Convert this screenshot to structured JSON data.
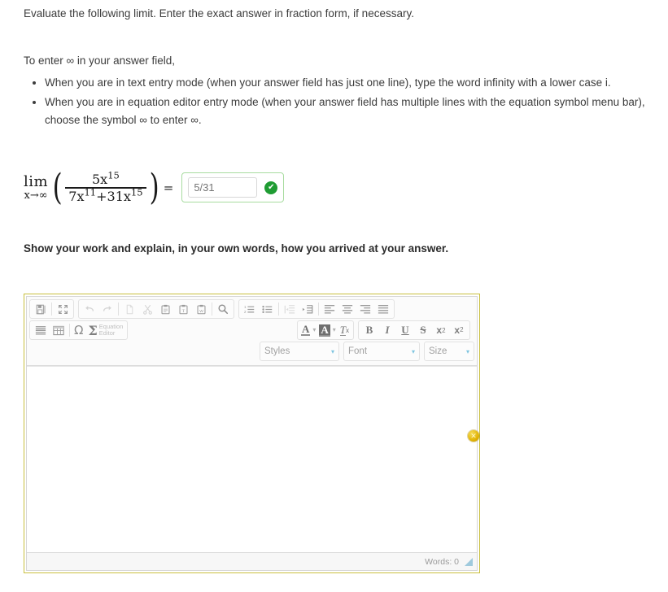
{
  "question": {
    "prompt": "Evaluate the following limit. Enter the exact answer in fraction form, if necessary.",
    "infinity_intro": "To enter ∞ in your answer field,",
    "bullets": [
      "When you are in text entry mode (when your answer field has just one line), type the word infinity with a lower case i.",
      "When you are in equation editor entry mode (when your answer field has multiple lines with the equation symbol menu bar), choose the symbol ∞ to enter ∞."
    ],
    "work_heading": "Show your work and explain, in your own words, how you arrived at your answer."
  },
  "math": {
    "lim_operator": "lim",
    "lim_subscript": "x→∞",
    "open_paren": "(",
    "close_paren": ")",
    "numerator_base": "5x",
    "numerator_exponent": "15",
    "denominator_term1_base": "7x",
    "denominator_term1_exponent": "11",
    "denominator_plus": "+",
    "denominator_term2_base": "31x",
    "denominator_term2_exponent": "15",
    "equals": "="
  },
  "answer": {
    "value": "5/31",
    "placeholder": "5/31",
    "status_icon": "✔",
    "status": "correct",
    "border_color": "#a8dca0",
    "badge_color": "#1f9c33"
  },
  "editor": {
    "outer_border_color": "#c9bf3f",
    "toolbar": {
      "group1": [
        {
          "name": "save-button",
          "glyph": "save",
          "disabled": false
        },
        {
          "name": "maximize-button",
          "glyph": "maximize",
          "disabled": false
        }
      ],
      "group2": [
        {
          "name": "undo-button",
          "glyph": "undo",
          "disabled": true
        },
        {
          "name": "redo-button",
          "glyph": "redo",
          "disabled": true
        },
        {
          "name": "copy-button",
          "glyph": "copy",
          "disabled": true
        },
        {
          "name": "cut-button",
          "glyph": "cut",
          "disabled": true
        },
        {
          "name": "paste-button",
          "glyph": "paste",
          "disabled": false
        },
        {
          "name": "paste-as-text-button",
          "glyph": "paste-text",
          "disabled": false
        },
        {
          "name": "paste-from-word-button",
          "glyph": "paste-word",
          "disabled": false
        },
        {
          "name": "find-button",
          "glyph": "search",
          "disabled": false
        }
      ],
      "group3": [
        {
          "name": "numbered-list-button",
          "glyph": "ordered-list",
          "disabled": false
        },
        {
          "name": "bulleted-list-button",
          "glyph": "unordered-list",
          "disabled": false
        },
        {
          "name": "decrease-indent-button",
          "glyph": "outdent",
          "disabled": true
        },
        {
          "name": "increase-indent-button",
          "glyph": "indent",
          "disabled": false
        },
        {
          "name": "align-left-button",
          "glyph": "align-left",
          "disabled": false
        },
        {
          "name": "align-center-button",
          "glyph": "align-center",
          "disabled": false
        },
        {
          "name": "align-right-button",
          "glyph": "align-right",
          "disabled": false
        },
        {
          "name": "justify-button",
          "glyph": "align-justify",
          "disabled": false
        }
      ],
      "group4": [
        {
          "name": "horizontal-rule-button",
          "glyph": "horizontal-rule"
        },
        {
          "name": "table-button",
          "glyph": "table"
        },
        {
          "name": "special-character-button",
          "glyph": "omega",
          "label": "Ω"
        },
        {
          "name": "equation-editor-button",
          "glyph": "sigma",
          "label": "Σ"
        }
      ],
      "equation_editor_label": "Equation\nEditor",
      "text_color_label": "A",
      "background_color_label": "A",
      "remove_format_label": "T",
      "remove_format_sub": "x",
      "bold_label": "B",
      "italic_label": "I",
      "underline_label": "U",
      "strike_label": "S",
      "subscript_label": "x",
      "subscript_sub": "2",
      "superscript_label": "x",
      "superscript_sup": "2",
      "selects": [
        {
          "name": "styles-select",
          "label": "Styles"
        },
        {
          "name": "font-select",
          "label": "Font"
        },
        {
          "name": "size-select",
          "label": "Size"
        }
      ]
    },
    "body_text": "",
    "status_bar": {
      "word_count_label": "Words: 0"
    }
  },
  "side_marker": {
    "name": "comment-marker",
    "glyph": "✕",
    "color": "#e0b100"
  }
}
